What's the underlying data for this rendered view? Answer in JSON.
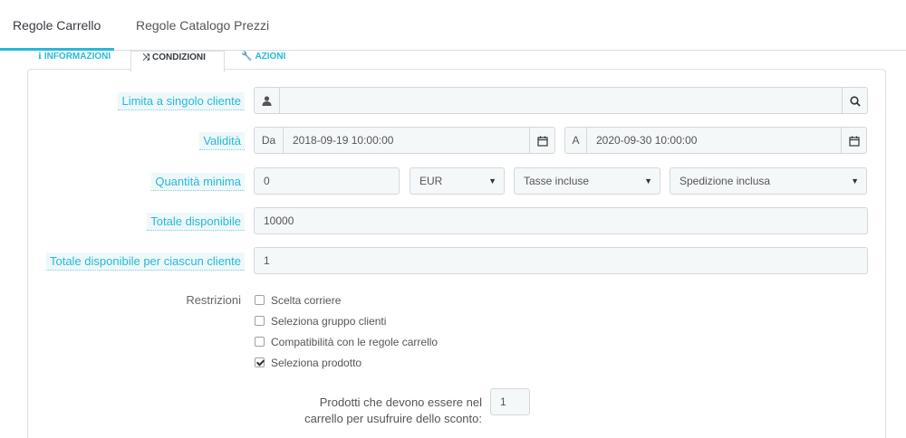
{
  "top_tabs": {
    "cart_rules": "Regole Carrello",
    "catalog_rules": "Regole Catalogo Prezzi"
  },
  "sub_tabs": {
    "information": "Informazioni",
    "conditions": "Condizioni",
    "actions": "Azioni"
  },
  "form": {
    "customer_label": "Limita a singolo cliente",
    "customer_value": "",
    "validity_label": "Validità",
    "from_prefix": "Da",
    "from_value": "2018-09-19 10:00:00",
    "to_prefix": "A",
    "to_value": "2020-09-30 10:00:00",
    "min_amount_label": "Quantità minima",
    "min_amount_value": "0",
    "currency": "EUR",
    "tax": "Tasse incluse",
    "shipping": "Spedizione inclusa",
    "total_available_label": "Totale disponibile",
    "total_available_value": "10000",
    "per_customer_label": "Totale disponibile per ciascun cliente",
    "per_customer_value": "1",
    "restrictions_label": "Restrizioni",
    "restrictions": [
      {
        "label": "Scelta corriere",
        "checked": false
      },
      {
        "label": "Seleziona gruppo clienti",
        "checked": false
      },
      {
        "label": "Compatibilità con le regole carrello",
        "checked": false
      },
      {
        "label": "Seleziona prodotto",
        "checked": true
      }
    ],
    "products_required_label": "Prodotti che devono essere nel carrello per usufruire dello sconto:",
    "products_required_value": "1"
  },
  "colors": {
    "accent": "#25b9d7",
    "label_bg": "#eef8fa",
    "field_bg": "#f5f8f9",
    "border": "#d3d8db"
  }
}
